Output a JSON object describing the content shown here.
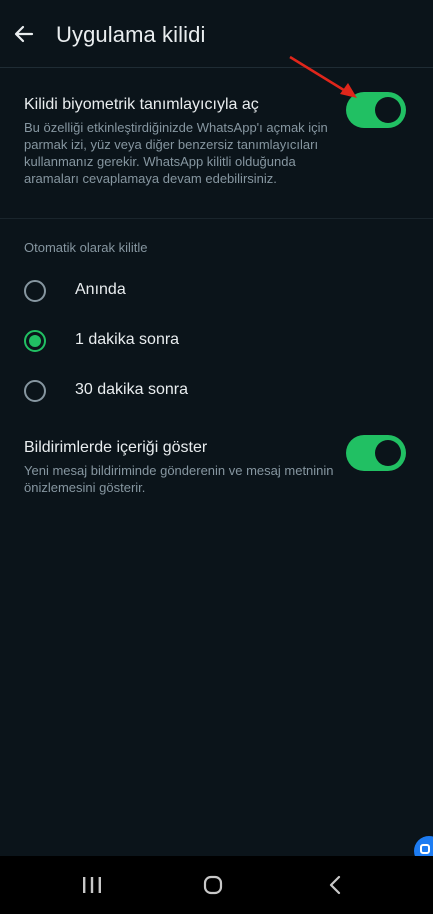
{
  "header": {
    "title": "Uygulama kilidi",
    "back_icon": "arrow-left-icon"
  },
  "biometric": {
    "title": "Kilidi biyometrik tanımlayıcıyla aç",
    "description": "Bu özelliği etkinleştirdiğinizde WhatsApp'ı açmak için parmak izi, yüz veya diğer benzersiz tanımlayıcıları kullanmanız gerekir. WhatsApp kilitli olduğunda aramaları cevaplamaya devam edebilirsiniz.",
    "enabled": true
  },
  "auto_lock": {
    "label": "Otomatik olarak kilitle",
    "options": [
      {
        "label": "Anında",
        "selected": false
      },
      {
        "label": "1 dakika sonra",
        "selected": true
      },
      {
        "label": "30 dakika sonra",
        "selected": false
      }
    ]
  },
  "notifications": {
    "title": "Bildirimlerde içeriği göster",
    "description": "Yeni mesaj bildiriminde gönderenin ve mesaj metninin önizlemesini gösterir.",
    "enabled": true
  },
  "colors": {
    "background": "#0b141a",
    "accent": "#21c063",
    "secondary_text": "#8696a0",
    "annotation_arrow": "#e0261b"
  },
  "nav_bar": {
    "icons": [
      "recent-apps-icon",
      "home-icon",
      "back-icon"
    ]
  }
}
